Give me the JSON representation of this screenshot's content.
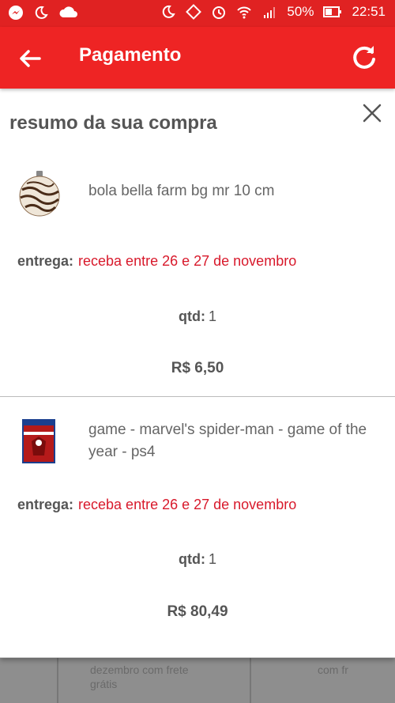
{
  "status_bar": {
    "battery": "50%",
    "time": "22:51"
  },
  "app_bar": {
    "title": "Pagamento"
  },
  "summary": {
    "title": "resumo da sua compra",
    "items": [
      {
        "name": "bola bella farm bg mr 10 cm",
        "delivery_label": "entrega:",
        "delivery_value": "receba entre 26 e 27 de novembro",
        "qty_label": "qtd:",
        "qty_value": "1",
        "price": "R$ 6,50"
      },
      {
        "name": "game - marvel's spider-man - game of the year - ps4",
        "delivery_label": "entrega:",
        "delivery_value": "receba entre 26 e 27 de novembro",
        "qty_label": "qtd:",
        "qty_value": "1",
        "price": "R$ 80,49"
      }
    ]
  },
  "background": {
    "text_left": "dezembro com frete grátis",
    "text_right": "com fr"
  },
  "colors": {
    "app_bar": "#ee2424",
    "status_bar": "#e02222",
    "delivery_text": "#d8192b"
  }
}
